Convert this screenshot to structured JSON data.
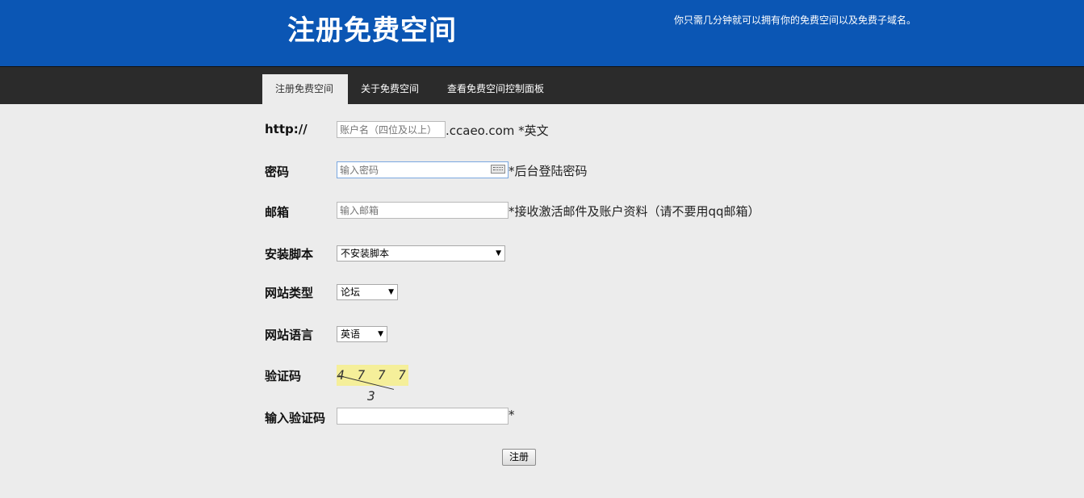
{
  "header": {
    "title": "注册免费空间",
    "tagline": "你只需几分钟就可以拥有你的免费空间以及免费子域名。"
  },
  "nav": {
    "items": [
      {
        "label": "注册免费空间",
        "active": true
      },
      {
        "label": "关于免费空间",
        "active": false
      },
      {
        "label": "查看免费空间控制面板",
        "active": false
      }
    ]
  },
  "form": {
    "account": {
      "label": "http://",
      "placeholder": "账户名（四位及以上）",
      "suffix": ".ccaeo.com *英文"
    },
    "password": {
      "label": "密码",
      "placeholder": "输入密码",
      "hint": "*后台登陆密码"
    },
    "email": {
      "label": "邮箱",
      "placeholder": "输入邮箱",
      "hint": "*接收激活邮件及账户资料（请不要用qq邮箱）"
    },
    "script": {
      "label": "安装脚本",
      "selected": "不安装脚本"
    },
    "site_type": {
      "label": "网站类型",
      "selected": "论坛"
    },
    "site_language": {
      "label": "网站语言",
      "selected": "英语"
    },
    "captcha": {
      "label": "验证码",
      "image_text": "4 7 7 7 3"
    },
    "captcha_input": {
      "label": "输入验证码",
      "value": "",
      "hint": "*"
    },
    "submit_label": "注册"
  },
  "colors": {
    "header_bg": "#0b56b4",
    "nav_bg": "#2b2b2b",
    "page_bg": "#ececec",
    "captcha_bg": "#f5ef9a"
  }
}
